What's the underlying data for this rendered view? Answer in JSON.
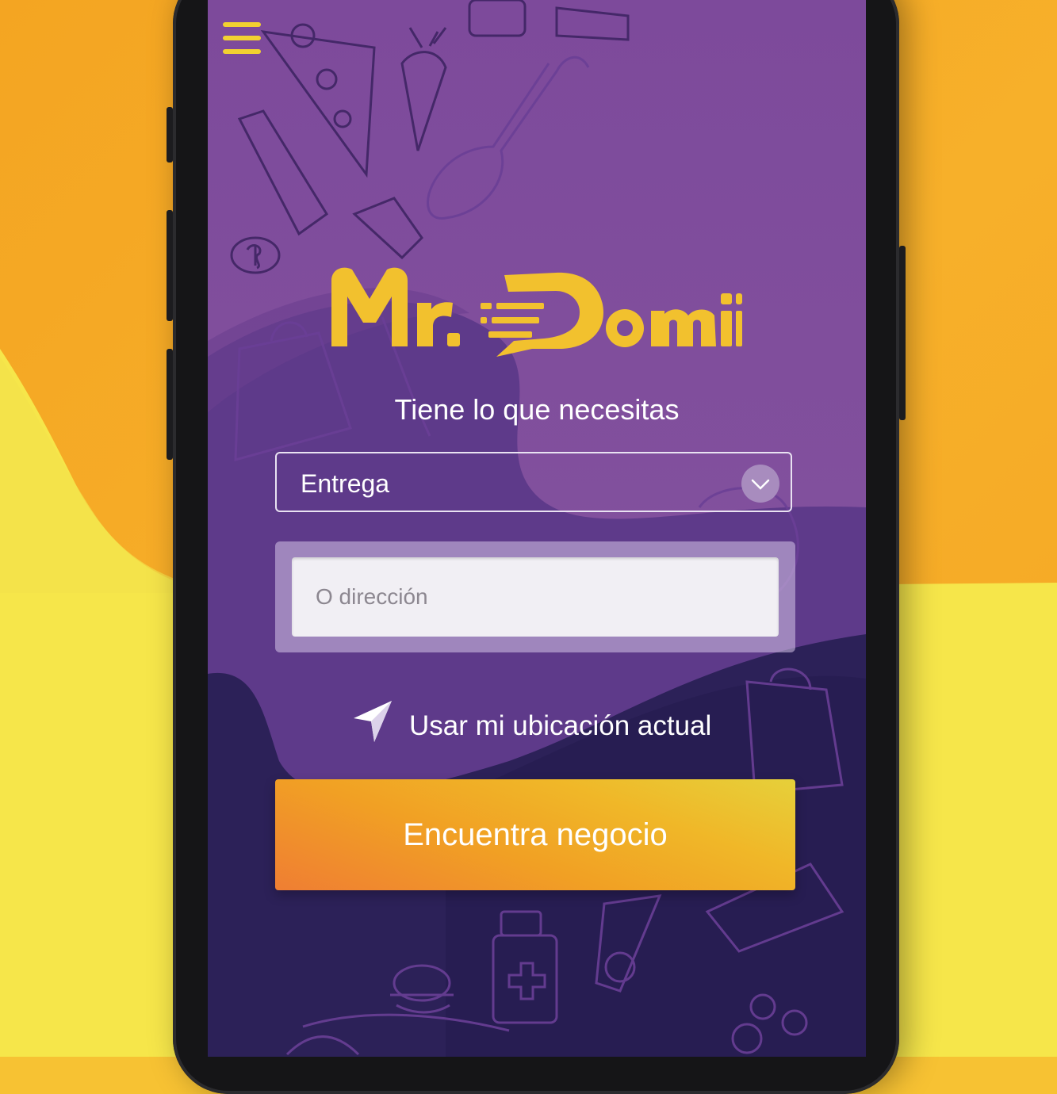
{
  "app": {
    "brand": "Mr. Domii",
    "tagline": "Tiene lo que necesitas"
  },
  "colors": {
    "accent": "#f2c12e",
    "purple": "#7a4c98",
    "dark_purple": "#2b1f52",
    "button_gradient_start": "#ef7e33",
    "button_gradient_end": "#e6d03a"
  },
  "menu": {
    "icon": "hamburger-icon"
  },
  "delivery_select": {
    "selected": "Entrega",
    "icon": "chevron-down-icon"
  },
  "address": {
    "placeholder": "O dirección",
    "value": ""
  },
  "location": {
    "label": "Usar mi ubicación actual",
    "icon": "location-arrow-icon"
  },
  "cta": {
    "label": "Encuentra negocio"
  }
}
